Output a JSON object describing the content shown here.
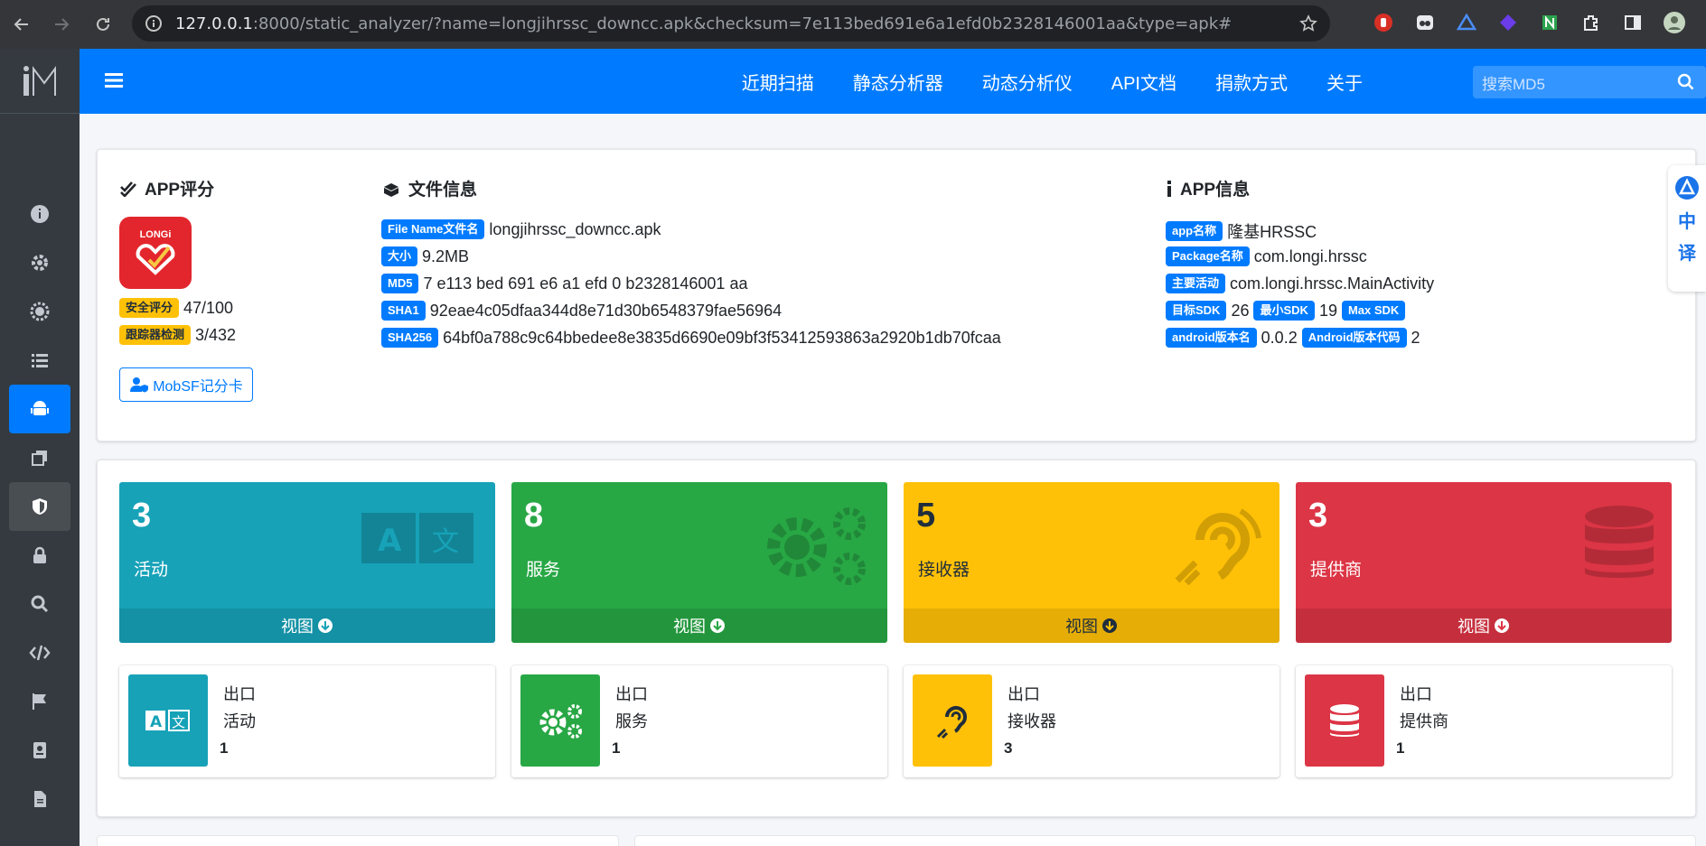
{
  "browser": {
    "url_host": "127.0.0.1",
    "url_rest": ":8000/static_analyzer/?name=longjihrssc_downcc.apk&checksum=7e113bed691e6a1efd0b2328146001aa&type=apk#"
  },
  "navbar": {
    "links": [
      "近期扫描",
      "静态分析器",
      "动态分析仪",
      "API文档",
      "捐款方式",
      "关于"
    ],
    "search_placeholder": "搜索MD5"
  },
  "app_score": {
    "title": "APP评分",
    "icon_text": "LONGi",
    "security_label": "安全评分",
    "security_value": "47/100",
    "tracker_label": "跟踪器检测",
    "tracker_value": "3/432",
    "scorecard_button": "MobSF记分卡"
  },
  "file_info": {
    "title": "文件信息",
    "rows": [
      {
        "label": "File Name文件名",
        "value": "longjihrssc_downcc.apk"
      },
      {
        "label": "大小",
        "value": "9.2MB"
      },
      {
        "label": "MD5",
        "value": "7 e113 bed 691 e6 a1 efd 0 b2328146001 aa"
      },
      {
        "label": "SHA1",
        "value": "92eae4c05dfaa344d8e71d30b6548379fae56964"
      },
      {
        "label": "SHA256",
        "value": "64bf0a788c9c64bbedee8e3835d6690e09bf3f53412593863a2920b1db70fcaa"
      }
    ]
  },
  "app_info": {
    "title": "APP信息",
    "app_name_label": "app名称",
    "app_name": "隆基HRSSC",
    "package_label": "Package名称",
    "package": "com.longi.hrssc",
    "main_activity_label": "主要活动",
    "main_activity": "com.longi.hrssc.MainActivity",
    "target_sdk_label": "目标SDK",
    "target_sdk": "26",
    "min_sdk_label": "最小SDK",
    "min_sdk": "19",
    "max_sdk_label": "Max SDK",
    "version_name_label": "android版本名",
    "version_name": "0.0.2",
    "version_code_label": "Android版本代码",
    "version_code": "2"
  },
  "components": {
    "view_label": "视图",
    "tiles": [
      {
        "count": "3",
        "label": "活动",
        "color": "#17a2b8"
      },
      {
        "count": "8",
        "label": "服务",
        "color": "#28a745"
      },
      {
        "count": "5",
        "label": "接收器",
        "color": "#ffc107"
      },
      {
        "count": "3",
        "label": "提供商",
        "color": "#dc3545"
      }
    ],
    "exported": [
      {
        "title": "出口",
        "label": "活动",
        "count": "1"
      },
      {
        "title": "出口",
        "label": "服务",
        "count": "1"
      },
      {
        "title": "出口",
        "label": "接收器",
        "count": "3"
      },
      {
        "title": "出口",
        "label": "提供商",
        "count": "1"
      }
    ]
  },
  "translate_widget": {
    "line1": "中",
    "line2": "译"
  }
}
